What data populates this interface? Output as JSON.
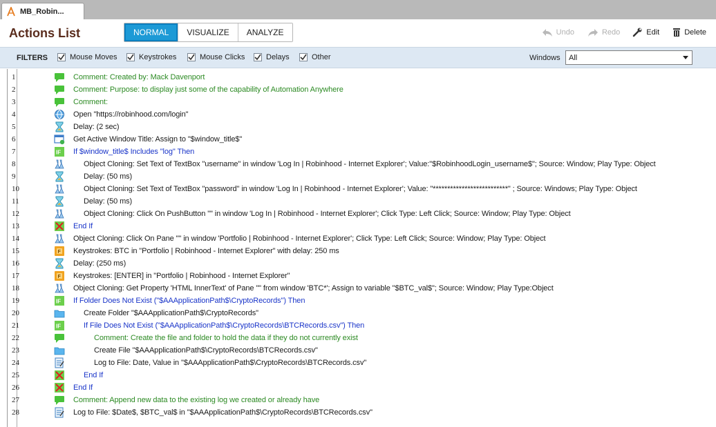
{
  "tab": {
    "label": "MB_Robin..."
  },
  "header": {
    "title": "Actions List",
    "view_tabs": [
      "NORMAL",
      "VISUALIZE",
      "ANALYZE"
    ],
    "active_view": "NORMAL",
    "tools": {
      "undo": "Undo",
      "redo": "Redo",
      "edit": "Edit",
      "delete": "Delete"
    }
  },
  "filters": {
    "label": "FILTERS",
    "items": [
      "Mouse Moves",
      "Keystrokes",
      "Mouse Clicks",
      "Delays",
      "Other"
    ],
    "windows_label": "Windows",
    "windows_value": "All"
  },
  "colors": {
    "accent": "#1d9ad6",
    "title": "#5a2c1d",
    "comment": "#2c8a23",
    "condition": "#1a35c9",
    "filterbar": "#dde8f3"
  },
  "rows": [
    {
      "num": "1",
      "icon": "comment-icon",
      "indent": 0,
      "style": "green",
      "text": "Comment: Created by: Mack Davenport"
    },
    {
      "num": "2",
      "icon": "comment-icon",
      "indent": 0,
      "style": "green",
      "text": "Comment: Purpose: to display just some of the capability of Automation Anywhere"
    },
    {
      "num": "3",
      "icon": "comment-icon",
      "indent": 0,
      "style": "green",
      "text": "Comment:"
    },
    {
      "num": "4",
      "icon": "browser-icon",
      "indent": 0,
      "style": "black",
      "text": "Open \"https://robinhood.com/login\""
    },
    {
      "num": "5",
      "icon": "hourglass-icon",
      "indent": 0,
      "style": "black",
      "text": "Delay: (2 sec)"
    },
    {
      "num": "6",
      "icon": "window-title-icon",
      "indent": 0,
      "style": "black",
      "text": "Get Active Window Title: Assign to \"$window_title$\""
    },
    {
      "num": "7",
      "icon": "if-icon",
      "indent": 0,
      "style": "blue",
      "text": "If $window_title$ Includes \"log\" Then"
    },
    {
      "num": "8",
      "icon": "flask-icon",
      "indent": 1,
      "style": "black",
      "text": "Object Cloning: Set Text of TextBox \"username\" in window 'Log In | Robinhood - Internet Explorer'; Value:\"$RobinhoodLogin_username$\"; Source: Window; Play Type: Object"
    },
    {
      "num": "9",
      "icon": "hourglass-icon",
      "indent": 1,
      "style": "black",
      "text": "Delay: (50 ms)"
    },
    {
      "num": "10",
      "icon": "flask-icon",
      "indent": 1,
      "style": "black",
      "text": "Object Cloning: Set Text of TextBox \"password\" in window 'Log In | Robinhood - Internet Explorer'; Value: \"**************************\" ; Source: Windows; Play Type: Object"
    },
    {
      "num": "11",
      "icon": "hourglass-icon",
      "indent": 1,
      "style": "black",
      "text": "Delay: (50 ms)"
    },
    {
      "num": "12",
      "icon": "flask-icon",
      "indent": 1,
      "style": "black",
      "text": "Object Cloning: Click On PushButton \"\" in window 'Log In | Robinhood - Internet Explorer'; Click Type: Left Click; Source: Window; Play Type: Object"
    },
    {
      "num": "13",
      "icon": "end-if-icon",
      "indent": 0,
      "style": "blue",
      "text": "End If"
    },
    {
      "num": "14",
      "icon": "flask-icon",
      "indent": 0,
      "style": "black",
      "text": "Object Cloning: Click On Pane \"\" in window 'Portfolio | Robinhood - Internet Explorer'; Click Type: Left Click; Source: Window; Play Type: Object"
    },
    {
      "num": "15",
      "icon": "keystrokes-icon",
      "indent": 0,
      "style": "black",
      "text": "Keystrokes: BTC in \"Portfolio | Robinhood - Internet Explorer\" with delay: 250 ms"
    },
    {
      "num": "16",
      "icon": "hourglass-icon",
      "indent": 0,
      "style": "black",
      "text": "Delay: (250 ms)"
    },
    {
      "num": "17",
      "icon": "keystrokes-icon",
      "indent": 0,
      "style": "black",
      "text": "Keystrokes: [ENTER] in \"Portfolio | Robinhood - Internet Explorer\""
    },
    {
      "num": "18",
      "icon": "flask-icon",
      "indent": 0,
      "style": "black",
      "text": "Object Cloning: Get Property 'HTML InnerText' of Pane \"\" from window 'BTC*'; Assign to variable \"$BTC_val$\"; Source: Window; Play Type:Object"
    },
    {
      "num": "19",
      "icon": "if-icon",
      "indent": 0,
      "style": "blue",
      "text": "If Folder Does Not Exist (\"$AAApplicationPath$\\CryptoRecords\") Then"
    },
    {
      "num": "20",
      "icon": "folder-icon",
      "indent": 1,
      "style": "black",
      "text": "Create Folder \"$AAApplicationPath$\\CryptoRecords\""
    },
    {
      "num": "21",
      "icon": "if-icon",
      "indent": 1,
      "style": "blue",
      "text": "If File Does Not Exist (\"$AAApplicationPath$\\CryptoRecords\\BTCRecords.csv\") Then"
    },
    {
      "num": "22",
      "icon": "comment-icon",
      "indent": 2,
      "style": "green",
      "text": "Comment: Create the file and folder to hold the data if they do not currently exist"
    },
    {
      "num": "23",
      "icon": "folder-icon",
      "indent": 2,
      "style": "black",
      "text": "Create File \"$AAApplicationPath$\\CryptoRecords\\BTCRecords.csv\""
    },
    {
      "num": "24",
      "icon": "log-file-icon",
      "indent": 2,
      "style": "black",
      "text": "Log to File: Date, Value in \"$AAApplicationPath$\\CryptoRecords\\BTCRecords.csv\""
    },
    {
      "num": "25",
      "icon": "end-if-icon",
      "indent": 1,
      "style": "blue",
      "text": "End If"
    },
    {
      "num": "26",
      "icon": "end-if-icon",
      "indent": 0,
      "style": "blue",
      "text": "End If"
    },
    {
      "num": "27",
      "icon": "comment-icon",
      "indent": 0,
      "style": "green",
      "text": "Comment: Append new data to the existing log we created or already have"
    },
    {
      "num": "28",
      "icon": "log-file-icon",
      "indent": 0,
      "style": "black",
      "text": "Log to File: $Date$, $BTC_val$ in \"$AAApplicationPath$\\CryptoRecords\\BTCRecords.csv\""
    }
  ]
}
